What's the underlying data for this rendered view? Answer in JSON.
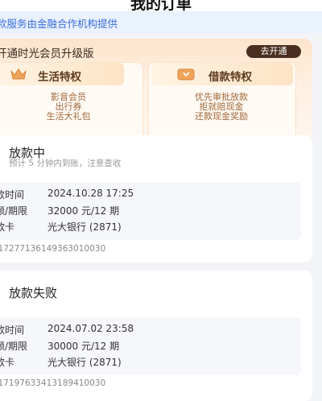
{
  "header": {
    "title": "我的订单"
  },
  "notice": {
    "text": "款服务由金融合作机构提供"
  },
  "membership": {
    "title": "开通时光会员升级版",
    "open_button": "去开通",
    "cards": [
      {
        "name": "生活特权",
        "icon": "crown-icon",
        "items": [
          "影音会员",
          "出行券",
          "生活大礼包"
        ]
      },
      {
        "name": "借款特权",
        "icon": "coupon-icon",
        "items": [
          "优先审批放款",
          "拒就赔现金",
          "还款现金奖励"
        ]
      }
    ]
  },
  "orders": [
    {
      "status": "放款中",
      "subtitle": "预计 5 分钟内到账，注意查收",
      "rows": [
        {
          "label": "款时间",
          "value": "2024.10.28 17:25"
        },
        {
          "label": "额/期限",
          "value": "32000 元/12 期"
        },
        {
          "label": "款卡",
          "value": "光大银行 (2871)"
        }
      ],
      "order_no": ":17277136149363010030"
    },
    {
      "status": "放款失败",
      "rows": [
        {
          "label": "款时间",
          "value": "2024.07.02 23:58"
        },
        {
          "label": "额/期限",
          "value": "30000 元/12 期"
        },
        {
          "label": "款卡",
          "value": "光大银行 (2871)"
        }
      ],
      "order_no": ":17197633413189410030"
    }
  ]
}
